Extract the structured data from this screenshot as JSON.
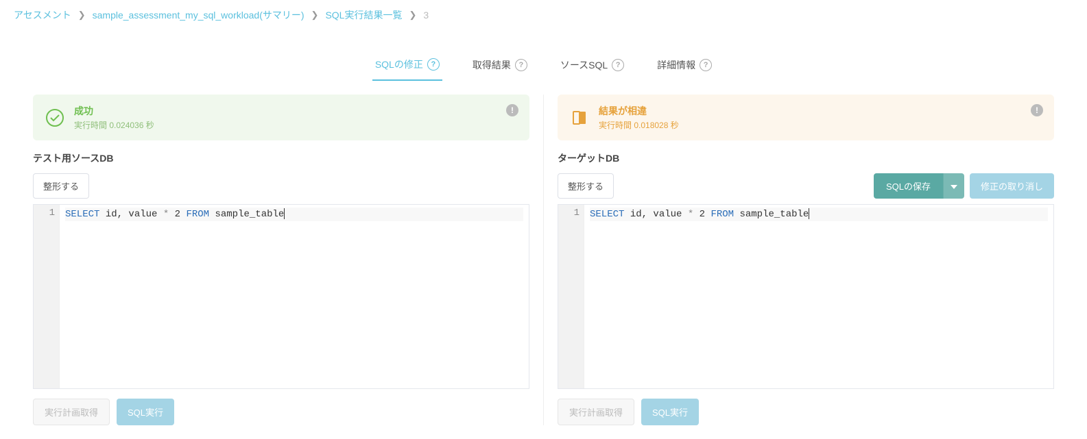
{
  "breadcrumb": {
    "items": [
      "アセスメント",
      "sample_assessment_my_sql_workload(サマリー)",
      "SQL実行結果一覧"
    ],
    "current": "3"
  },
  "tabs": {
    "sql_fix": "SQLの修正",
    "fetch_result": "取得結果",
    "source_sql": "ソースSQL",
    "details": "詳細情報"
  },
  "left": {
    "status_title": "成功",
    "status_sub": "実行時間 0.024036 秒",
    "section_label": "テスト用ソースDB",
    "format_btn": "整形する",
    "sql_tokens": [
      {
        "t": "SELECT",
        "c": "kw-blue"
      },
      {
        "t": " id, value ",
        "c": ""
      },
      {
        "t": "*",
        "c": "kw-star"
      },
      {
        "t": " ",
        "c": ""
      },
      {
        "t": "2",
        "c": ""
      },
      {
        "t": " ",
        "c": ""
      },
      {
        "t": "FROM",
        "c": "kw-blue"
      },
      {
        "t": " sample_table",
        "c": ""
      }
    ],
    "plan_btn": "実行計画取得",
    "exec_btn": "SQL実行"
  },
  "right": {
    "status_title": "結果が相違",
    "status_sub": "実行時間 0.018028 秒",
    "section_label": "ターゲットDB",
    "format_btn": "整形する",
    "save_btn": "SQLの保存",
    "undo_btn": "修正の取り消し",
    "sql_tokens": [
      {
        "t": "SELECT",
        "c": "kw-blue"
      },
      {
        "t": " id, value ",
        "c": ""
      },
      {
        "t": "*",
        "c": "kw-star"
      },
      {
        "t": " ",
        "c": ""
      },
      {
        "t": "2",
        "c": ""
      },
      {
        "t": " ",
        "c": ""
      },
      {
        "t": "FROM",
        "c": "kw-blue"
      },
      {
        "t": " sample_table",
        "c": ""
      }
    ],
    "plan_btn": "実行計画取得",
    "exec_btn": "SQL実行"
  },
  "line_number": "1"
}
